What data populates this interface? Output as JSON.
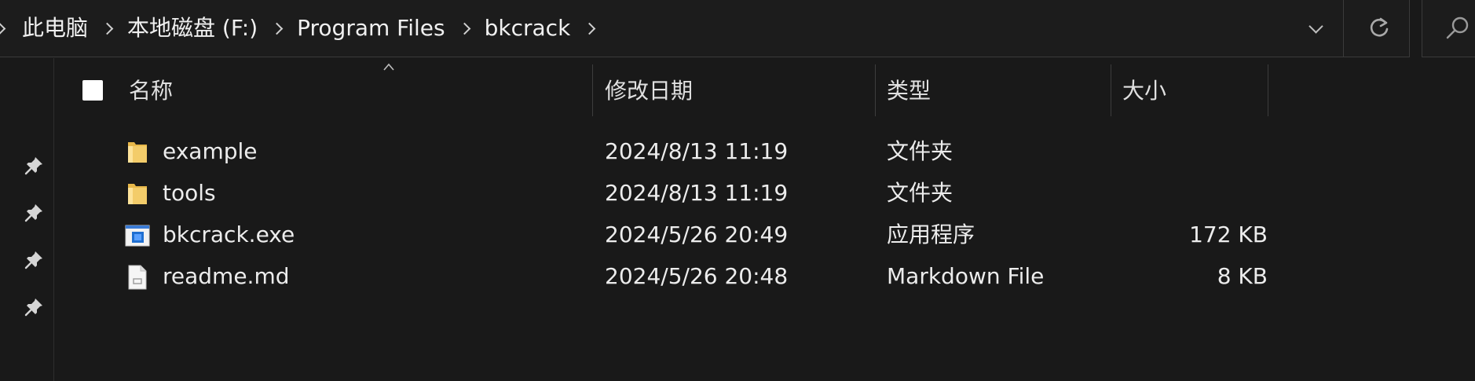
{
  "address_bar": {
    "breadcrumbs": [
      "此电脑",
      "本地磁盘 (F:)",
      "Program Files",
      "bkcrack"
    ]
  },
  "columns": {
    "name": "名称",
    "modified": "修改日期",
    "type": "类型",
    "size": "大小",
    "sort_indicator": "ascending"
  },
  "files": [
    {
      "name": "example",
      "modified": "2024/8/13 11:19",
      "type": "文件夹",
      "size": "",
      "icon": "folder-icon"
    },
    {
      "name": "tools",
      "modified": "2024/8/13 11:19",
      "type": "文件夹",
      "size": "",
      "icon": "folder-icon"
    },
    {
      "name": "bkcrack.exe",
      "modified": "2024/5/26 20:49",
      "type": "应用程序",
      "size": "172 KB",
      "icon": "exe-icon"
    },
    {
      "name": "readme.md",
      "modified": "2024/5/26 20:48",
      "type": "Markdown File",
      "size": "8 KB",
      "icon": "document-icon"
    }
  ],
  "quick_access_pins": 4,
  "colors": {
    "background": "#191919",
    "text": "#e6e6e6",
    "folder": "#f0c75e",
    "exe_accent": "#1f6fd1"
  }
}
